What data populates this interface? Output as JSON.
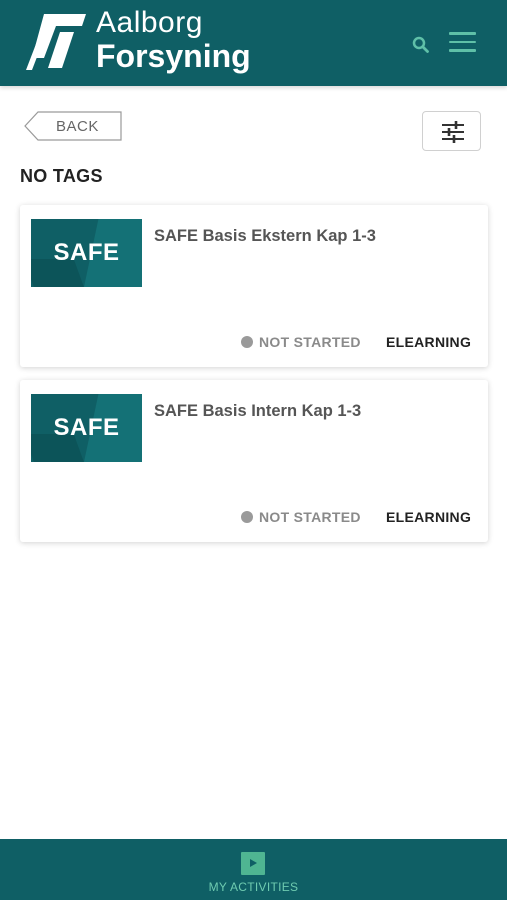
{
  "header": {
    "logo_line1": "Aalborg",
    "logo_line2": "Forsyning",
    "brand_color": "#0f5f65",
    "accent_color": "#5fc0a8",
    "search_icon": "search-icon",
    "menu_icon": "hamburger-menu-icon"
  },
  "toolbar": {
    "back_label": "BACK",
    "filter_icon": "sliders-filter-icon"
  },
  "section": {
    "title": "NO TAGS"
  },
  "cards": [
    {
      "thumb_text": "SAFE",
      "title": "SAFE Basis Ekstern Kap 1-3",
      "status": "NOT STARTED",
      "type": "ELEARNING"
    },
    {
      "thumb_text": "SAFE",
      "title": "SAFE Basis Intern Kap 1-3",
      "status": "NOT STARTED",
      "type": "ELEARNING"
    }
  ],
  "bottom_nav": {
    "label": "MY ACTIVITIES",
    "icon": "play-icon"
  }
}
